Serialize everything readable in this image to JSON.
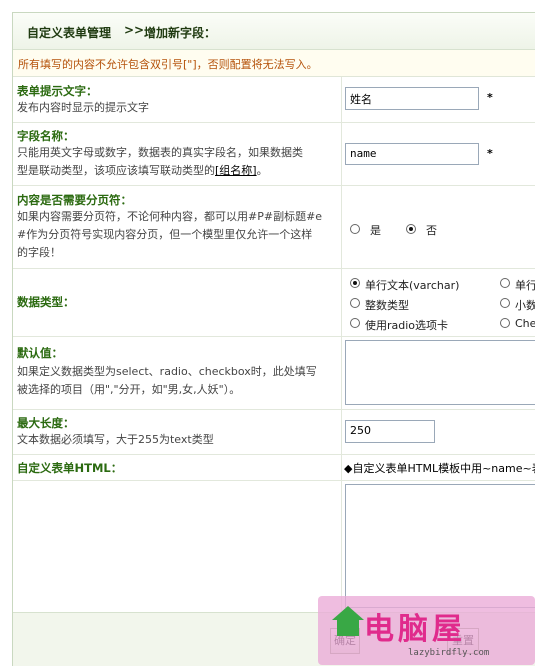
{
  "header": {
    "section": "自定义表单管理",
    "separator": ">>",
    "page_title": "增加新字段："
  },
  "notice": "所有填写的内容不允许包含双引号[\"]，否则配置将无法写入。",
  "fields": {
    "prompt_text": {
      "label": "表单提示文字：",
      "desc": "发布内容时显示的提示文字",
      "value": "姓名",
      "required": "*"
    },
    "field_name": {
      "label": "字段名称：",
      "desc_line1": "只能用英文字母或数字，数据表的真实字段名，如果数据类",
      "desc_line2": "型是联动类型，该项应该填写联动类型的",
      "desc_link": "[组名称]",
      "desc_end": "。",
      "value": "name",
      "required": "*"
    },
    "paging": {
      "label": "内容是否需要分页符：",
      "desc_line1": "如果内容需要分页符，不论何种内容，都可以用#P#副标题#e",
      "desc_line2": "#作为分页符号实现内容分页，但一个模型里仅允许一个这样",
      "desc_line3": "的字段！",
      "opt_yes": "是",
      "opt_no": "否",
      "selected": "否"
    },
    "data_type": {
      "label": "数据类型：",
      "options": [
        "单行文本(varchar)",
        "单行",
        "整数类型",
        "小数",
        "使用radio选项卡",
        "Chec"
      ],
      "selected": "单行文本(varchar)"
    },
    "default_value": {
      "label": "默认值：",
      "desc_line1": "如果定义数据类型为select、radio、checkbox时，此处填写",
      "desc_line2": "被选择的项目（用\",\"分开，如\"男,女,人妖\"）。",
      "value": ""
    },
    "max_length": {
      "label": "最大长度：",
      "desc": "文本数据必须填写，大于255为text类型",
      "value": "250"
    },
    "custom_html": {
      "label": "自定义表单HTML：",
      "hint": "◆自定义表单HTML模板中用~name~表"
    }
  },
  "footer": {
    "confirm": "确定",
    "reset": "重置"
  },
  "watermark": {
    "brand": "电脑屋",
    "url": "lazybirdfly.com"
  }
}
